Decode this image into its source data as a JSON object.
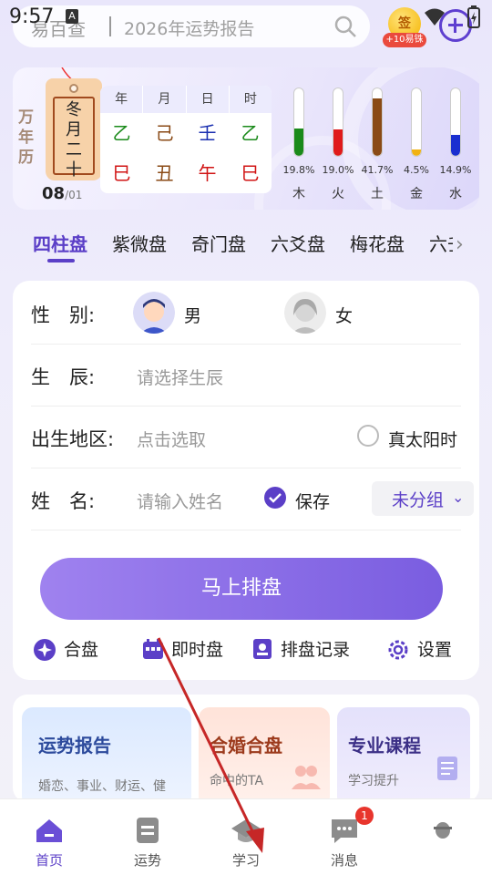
{
  "status_bar": {
    "time": "9:57",
    "notif_badge": "A"
  },
  "search": {
    "brand": "易百查",
    "placeholder": "2026年运势报告"
  },
  "checkin": {
    "icon_text": "签",
    "reward": "+10易铢"
  },
  "calendar": {
    "wannianli": [
      "万",
      "年",
      "历"
    ],
    "lunar": [
      "冬",
      "月",
      "二",
      "十"
    ],
    "day": "08",
    "month": "/01",
    "pillar_headers": [
      "年",
      "月",
      "日",
      "时"
    ],
    "stems": [
      {
        "char": "乙",
        "color": "#1a8a1a"
      },
      {
        "char": "己",
        "color": "#8a4a16"
      },
      {
        "char": "壬",
        "color": "#1a2fb0"
      },
      {
        "char": "乙",
        "color": "#1a8a1a"
      }
    ],
    "branches": [
      {
        "char": "巳",
        "color": "#d11414"
      },
      {
        "char": "丑",
        "color": "#8a4a16"
      },
      {
        "char": "午",
        "color": "#d11414"
      },
      {
        "char": "巳",
        "color": "#d11414"
      }
    ],
    "elements": [
      {
        "name": "木",
        "percent_label": "19.8%",
        "value": 19.8,
        "color": "#1a8a1a"
      },
      {
        "name": "火",
        "percent_label": "19.0%",
        "value": 19.0,
        "color": "#e01b1b"
      },
      {
        "name": "土",
        "percent_label": "41.7%",
        "value": 41.7,
        "color": "#8a4a16"
      },
      {
        "name": "金",
        "percent_label": "4.5%",
        "value": 4.5,
        "color": "#f1b214"
      },
      {
        "name": "水",
        "percent_label": "14.9%",
        "value": 14.9,
        "color": "#1a2fd0"
      }
    ]
  },
  "tabs": [
    "四柱盘",
    "紫微盘",
    "奇门盘",
    "六爻盘",
    "梅花盘",
    "六壬"
  ],
  "form": {
    "gender_label": "性　别:",
    "male": "男",
    "female": "女",
    "birth_label": "生　辰:",
    "birth_placeholder": "请选择生辰",
    "place_label": "出生地区:",
    "place_placeholder": "点击选取",
    "true_solar": "真太阳时",
    "name_label": "姓　名:",
    "name_placeholder": "请输入姓名",
    "save": "保存",
    "group": "未分组",
    "submit": "马上排盘"
  },
  "tools": [
    "合盘",
    "即时盘",
    "排盘记录",
    "设置"
  ],
  "cards": [
    {
      "title": "运势报告",
      "subtitle": "婚恋、事业、财运、健"
    },
    {
      "title": "合婚合盘",
      "subtitle": "命中的TA"
    },
    {
      "title": "专业课程",
      "subtitle": "学习提升"
    }
  ],
  "nav": [
    {
      "label": "首页",
      "active": true
    },
    {
      "label": "运势"
    },
    {
      "label": "学习"
    },
    {
      "label": "消息",
      "badge": "1"
    },
    {
      "label": ""
    }
  ],
  "colors": {
    "accent": "#5b3fc7",
    "button_start": "#9f82ef",
    "button_end": "#7a5de0"
  }
}
